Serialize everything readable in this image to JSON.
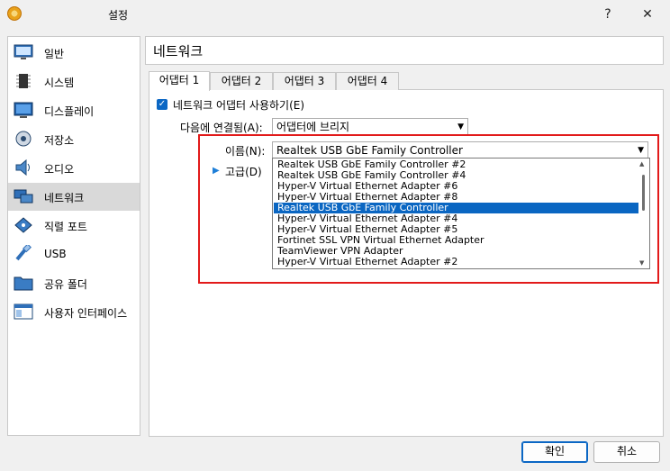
{
  "window": {
    "title": "설정",
    "help_label": "?",
    "close_label": "✕"
  },
  "sidebar": {
    "items": [
      {
        "label": "일반",
        "icon": "monitor-general-icon"
      },
      {
        "label": "시스템",
        "icon": "chip-icon"
      },
      {
        "label": "디스플레이",
        "icon": "display-icon"
      },
      {
        "label": "저장소",
        "icon": "disk-icon"
      },
      {
        "label": "오디오",
        "icon": "speaker-icon"
      },
      {
        "label": "네트워크",
        "icon": "network-icon",
        "selected": true
      },
      {
        "label": "직렬 포트",
        "icon": "serial-port-icon"
      },
      {
        "label": "USB",
        "icon": "usb-icon"
      },
      {
        "label": "공유 폴더",
        "icon": "folder-icon"
      },
      {
        "label": "사용자 인터페이스",
        "icon": "ui-icon"
      }
    ]
  },
  "main": {
    "title": "네트워크",
    "tabs": [
      {
        "label": "어댑터 1",
        "active": true
      },
      {
        "label": "어댑터 2"
      },
      {
        "label": "어댑터 3"
      },
      {
        "label": "어댑터 4"
      }
    ],
    "enable_adapter_label": "네트워크 어댑터 사용하기(E)",
    "attached_to_label": "다음에 연결됨(A):",
    "attached_to_value": "어댑터에 브리지",
    "name_label": "이름(N):",
    "name_value": "Realtek USB GbE Family Controller",
    "advanced_label": "고급(D)",
    "options": [
      "Realtek USB GbE Family Controller #2",
      "Realtek USB GbE Family Controller #4",
      "Hyper-V Virtual Ethernet Adapter #6",
      "Hyper-V Virtual Ethernet Adapter #8",
      "Realtek USB GbE Family Controller",
      "Hyper-V Virtual Ethernet Adapter #4",
      "Hyper-V Virtual Ethernet Adapter #5",
      "Fortinet SSL VPN Virtual Ethernet Adapter",
      "TeamViewer VPN Adapter",
      "Hyper-V Virtual Ethernet Adapter #2"
    ],
    "selected_option_index": 4
  },
  "footer": {
    "ok_label": "확인",
    "cancel_label": "취소"
  },
  "colors": {
    "accent": "#0a66c2",
    "highlight_border": "#e21a1a"
  }
}
